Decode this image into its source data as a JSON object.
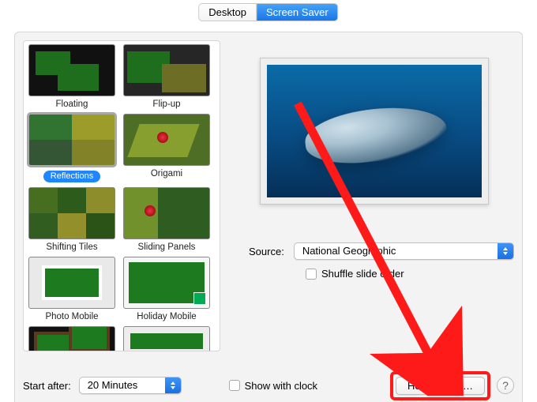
{
  "tabs": {
    "desktop": "Desktop",
    "screensaver": "Screen Saver"
  },
  "grid": {
    "items": [
      {
        "label": "Floating"
      },
      {
        "label": "Flip-up"
      },
      {
        "label": "Reflections"
      },
      {
        "label": "Origami"
      },
      {
        "label": "Shifting Tiles"
      },
      {
        "label": "Sliding Panels"
      },
      {
        "label": "Photo Mobile"
      },
      {
        "label": "Holiday Mobile"
      }
    ],
    "selected_index": 2
  },
  "source": {
    "label": "Source:",
    "value": "National Geographic"
  },
  "shuffle": {
    "label": "Shuffle slide order",
    "checked": false
  },
  "start_after": {
    "label": "Start after:",
    "value": "20 Minutes"
  },
  "show_clock": {
    "label": "Show with clock",
    "checked": false
  },
  "hot_corners": {
    "label": "Hot Corners…"
  },
  "help_symbol": "?"
}
